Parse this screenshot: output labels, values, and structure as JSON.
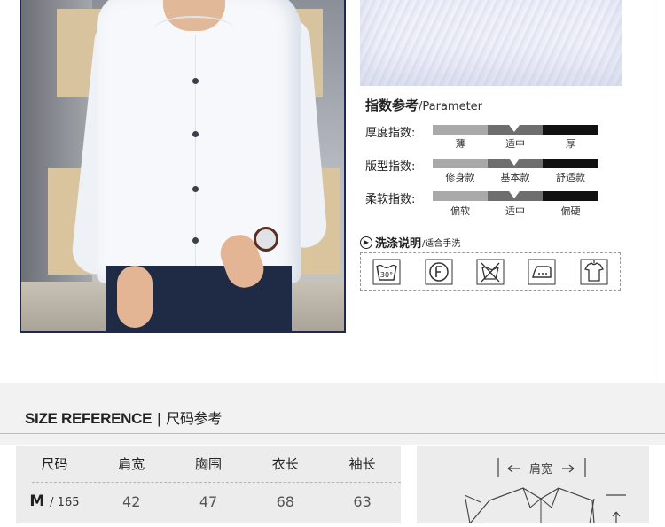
{
  "parameter": {
    "title_cn": "指数参考",
    "title_en": "/Parameter",
    "rows": [
      {
        "label": "厚度指数:",
        "ticks": [
          "薄",
          "适中",
          "厚"
        ],
        "selected": "适中"
      },
      {
        "label": "版型指数:",
        "ticks": [
          "修身款",
          "基本款",
          "舒适款"
        ],
        "selected": "基本款"
      },
      {
        "label": "柔软指数:",
        "ticks": [
          "偏软",
          "适中",
          "偏硬"
        ],
        "selected": "适中"
      }
    ]
  },
  "wash": {
    "title": "洗涤说明",
    "subtitle": "/适合手洗",
    "temp": "30°",
    "icons": [
      "wash-30-icon",
      "dry-clean-icon",
      "no-tumble-dry-icon",
      "iron-icon",
      "hang-dry-icon"
    ]
  },
  "size_reference": {
    "title_en": "SIZE REFERENCE",
    "separator": "|",
    "title_cn": "尺码参考",
    "columns": [
      "尺码",
      "肩宽",
      "胸围",
      "衣长",
      "袖长"
    ],
    "rows": [
      {
        "size": "M",
        "height": "/ 165",
        "values": [
          "42",
          "47",
          "68",
          "63"
        ]
      }
    ]
  },
  "diagram": {
    "shoulder_label": "肩宽"
  }
}
